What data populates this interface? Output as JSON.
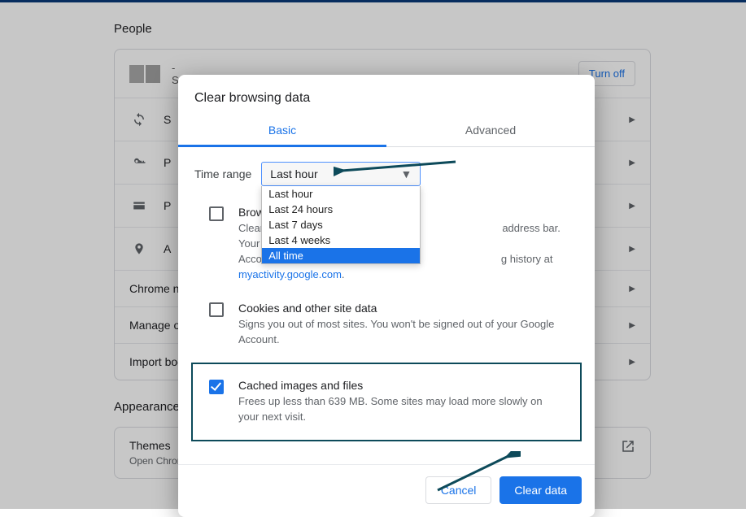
{
  "sections": {
    "people_title": "People",
    "appearance_title": "Appearance"
  },
  "profile": {
    "line1": "- ",
    "line2": "S",
    "turnoff": "Turn off"
  },
  "rows": {
    "sync": "S",
    "passwords": "P",
    "payments": "P",
    "addresses": "A",
    "chrome_name": "Chrome na",
    "manage": "Manage ot",
    "import": "Import boo"
  },
  "themes": {
    "title": "Themes",
    "sub": "Open Chrome Web Store"
  },
  "dialog": {
    "title": "Clear browsing data",
    "tabs": {
      "basic": "Basic",
      "advanced": "Advanced"
    },
    "time_range_label": "Time range",
    "select_value": "Last hour",
    "options": [
      "Last hour",
      "Last 24 hours",
      "Last 7 days",
      "Last 4 weeks",
      "All time"
    ],
    "browsing": {
      "title": "Browsi",
      "desc1": "Clears",
      "desc2": "address bar. Your Google",
      "desc3": "Accou",
      "desc4": "g history at",
      "link": "myactivity.google.com"
    },
    "cookies": {
      "title": "Cookies and other site data",
      "desc": "Signs you out of most sites. You won't be signed out of your Google Account."
    },
    "cache": {
      "title": "Cached images and files",
      "desc": "Frees up less than 639 MB. Some sites may load more slowly on your next visit."
    },
    "cancel": "Cancel",
    "clear": "Clear data"
  }
}
